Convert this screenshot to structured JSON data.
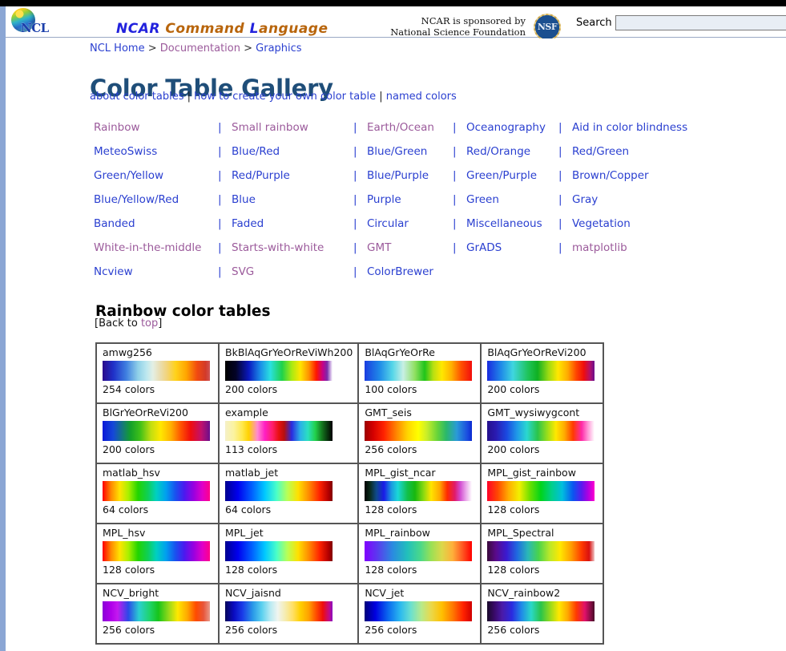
{
  "site": {
    "logo_alt": "NCL",
    "wordmark": [
      {
        "text": "NCAR",
        "color": "#2222dd"
      },
      {
        "text": "Command",
        "color": "#b8650c"
      },
      {
        "text": "L",
        "color": "#2222dd"
      },
      {
        "text": "anguage",
        "color": "#b8650c"
      }
    ],
    "sponsor_line1": "NCAR is sponsored by",
    "sponsor_line2": "National Science Foundation",
    "nsf_seal_text": "NSF"
  },
  "search": {
    "label": "Search",
    "value": "",
    "placeholder": ""
  },
  "breadcrumb": {
    "items": [
      {
        "label": "NCL Home",
        "visited": false
      },
      {
        "label": "Documentation",
        "visited": true
      },
      {
        "label": "Graphics",
        "visited": false
      }
    ],
    "separator": ">"
  },
  "page": {
    "title": "Color Table Gallery",
    "sublinks": [
      {
        "label": "about color tables",
        "visited": false
      },
      {
        "label": "how to create your own color table",
        "visited": false
      },
      {
        "label": "named colors",
        "visited": false
      }
    ],
    "sublink_separator": "|"
  },
  "categories": {
    "separator": "|",
    "rows": [
      [
        {
          "label": "Rainbow",
          "visited": true
        },
        {
          "label": "Small rainbow",
          "visited": true
        },
        {
          "label": "Earth/Ocean",
          "visited": true
        },
        {
          "label": "Oceanography",
          "visited": false
        },
        {
          "label": "Aid in color blindness",
          "visited": false
        }
      ],
      [
        {
          "label": "MeteoSwiss",
          "visited": false
        },
        {
          "label": "Blue/Red",
          "visited": false
        },
        {
          "label": "Blue/Green",
          "visited": false
        },
        {
          "label": "Red/Orange",
          "visited": false
        },
        {
          "label": "Red/Green",
          "visited": false
        }
      ],
      [
        {
          "label": "Green/Yellow",
          "visited": false
        },
        {
          "label": "Red/Purple",
          "visited": false
        },
        {
          "label": "Blue/Purple",
          "visited": false
        },
        {
          "label": "Green/Purple",
          "visited": false
        },
        {
          "label": "Brown/Copper",
          "visited": false
        }
      ],
      [
        {
          "label": "Blue/Yellow/Red",
          "visited": false
        },
        {
          "label": "Blue",
          "visited": false
        },
        {
          "label": "Purple",
          "visited": false
        },
        {
          "label": "Green",
          "visited": false
        },
        {
          "label": "Gray",
          "visited": false
        }
      ],
      [
        {
          "label": "Banded",
          "visited": false
        },
        {
          "label": "Faded",
          "visited": false
        },
        {
          "label": "Circular",
          "visited": false
        },
        {
          "label": "Miscellaneous",
          "visited": false
        },
        {
          "label": "Vegetation",
          "visited": false
        }
      ],
      [
        {
          "label": "White-in-the-middle",
          "visited": true
        },
        {
          "label": "Starts-with-white",
          "visited": true
        },
        {
          "label": "GMT",
          "visited": true
        },
        {
          "label": "GrADS",
          "visited": false
        },
        {
          "label": "matplotlib",
          "visited": true
        }
      ],
      [
        {
          "label": "Ncview",
          "visited": false
        },
        {
          "label": "SVG",
          "visited": true
        },
        {
          "label": "ColorBrewer",
          "visited": false
        },
        {
          "label": "",
          "visited": false
        },
        {
          "label": "",
          "visited": false
        }
      ]
    ]
  },
  "section": {
    "heading": "Rainbow color tables",
    "back_prefix": "[Back to ",
    "back_link": "top",
    "back_suffix": "]"
  },
  "color_tables": [
    {
      "name": "amwg256",
      "count": "254 colors",
      "gradient": "linear-gradient(to right, #2a0a8c 0%, #1f30c8 10%, #3f7fe0 22%, #8fd0e8 33%, #bde8ef 41%, #e4efe4 47%, #e9dfb6 53%, #f2d37a 60%, #ffd21a 68%, #ffa500 78%, #f24a10 88%, #d23a2a 96%, #cf5555 100%)"
    },
    {
      "name": "BkBlAqGrYeOrReViWh200",
      "count": "200 colors",
      "gradient": "linear-gradient(to right, #000000 0%, #030327 10%, #0a18c0 22%, #1a8fe8 33%, #2ae0e0 42%, #1fd24a 53%, #a8ea12 62%, #ffe600 70%, #ff9000 78%, #ff1500 85%, #c4008c 91%, #7a2aa8 95%, #c9a8e0 98%, #ffffff 100%)"
    },
    {
      "name": "BlAqGrYeOrRe",
      "count": "100 colors",
      "gradient": "linear-gradient(to right, #1a3ce0 0%, #1f8ae8 14%, #55d6e8 26%, #c8efe4 36%, #8fe060 47%, #1fc41a 56%, #b8e012 64%, #ffe800 72%, #ffb000 81%, #ff5000 90%, #f20d0d 100%)"
    },
    {
      "name": "BlAqGrYeOrReVi200",
      "count": "200 colors",
      "gradient": "linear-gradient(to right, #1a2ae0 0%, #1f8ae8 13%, #3fd6e0 24%, #1fc45a 38%, #0fb022 47%, #9ada12 57%, #ffe800 66%, #ffab00 75%, #ff4500 83%, #ef0d0d 90%, #b0106e 96%, #6a0f8c 100%)"
    },
    {
      "name": "BlGrYeOrReVi200",
      "count": "200 colors",
      "gradient": "linear-gradient(to right, #0a18d8 0%, #1548d8 10%, #13a02a 26%, #3fc018 35%, #c2de10 45%, #ffe800 54%, #ffae00 64%, #ff5200 73%, #f00d0d 82%, #c0106e 92%, #6a0f8c 100%)"
    },
    {
      "name": "example",
      "count": "113 colors",
      "gradient": "linear-gradient(to right, #f5f0c8 0%, #fbf3a0 8%, #ffe84a 16%, #ffd100 22%, #ff8ad0 30%, #ff1fc4 37%, #ff1f6a 44%, #e81010 50%, #b51010 55%, #2a2ae0 62%, #2ab0e8 70%, #2ae0c0 77%, #22d04a 84%, #147a1f 90%, #0a3a10 95%, #000000 100%)"
    },
    {
      "name": "GMT_seis",
      "count": "256 colors",
      "gradient": "linear-gradient(to right, #9b0000 0%, #d40000 8%, #ff2200 18%, #ff8800 30%, #ffd500 40%, #ffff00 50%, #c8ee2a 58%, #66d43a 68%, #2ab86a 76%, #2a9ad8 86%, #1a4ae0 96%, #0b2ad0 100%)"
    },
    {
      "name": "GMT_wysiwygcont",
      "count": "200 colors",
      "gradient": "linear-gradient(to right, #25108c 0%, #2a1ab0 8%, #1a48e0 18%, #1f9ae8 28%, #2ad8d0 37%, #2ac44a 47%, #9ade1a 56%, #ffe800 64%, #ffab00 72%, #ff3a00 80%, #ff2aa8 88%, #ff9ad8 94%, #ffffff 100%)"
    },
    {
      "name": "matlab_hsv",
      "count": "64 colors",
      "gradient": "linear-gradient(to right, #ff0000 0%, #ff8a00 8%, #ffe400 16%, #aaf000 24%, #22d400 33%, #0fcf55 42%, #00d0c0 50%, #00a0ef 59%, #1a50ef 68%, #4a1aef 76%, #9a00e0 85%, #e000c8 93%, #ff0088 100%)"
    },
    {
      "name": "matlab_jet",
      "count": "64 colors",
      "gradient": "linear-gradient(to right, #00008f 0%, #0000ef 12%, #0060ff 25%, #00c8ff 37%, #4affc8 48%, #b8ff55 58%, #ffe000 68%, #ff8a00 78%, #ff2200 88%, #b50000 96%, #800000 100%)"
    },
    {
      "name": "MPL_gist_ncar",
      "count": "128 colors",
      "gradient": "linear-gradient(to right, #000000 0%, #0a2a1a 5%, #0f4a8a 11%, #1a1ae8 18%, #1a9ae0 25%, #1ad8d8 31%, #12c04a 40%, #18b80f 47%, #8ada10 55%, #ffe400 62%, #ffa800 70%, #ff2a00 77%, #e01a6a 84%, #d24ad0 89%, #e8a0e8 94%, #ffffff 100%)"
    },
    {
      "name": "MPL_gist_rainbow",
      "count": "128 colors",
      "gradient": "linear-gradient(to right, #ff0028 0%, #ff4a00 10%, #ffae00 20%, #f2f000 30%, #6ae000 40%, #00d41a 50%, #00cf8a 60%, #00bede 70%, #0a55f0 80%, #5a1aef 88%, #b000e0 94%, #ff00d0 100%)"
    },
    {
      "name": "MPL_hsv",
      "count": "128 colors",
      "gradient": "linear-gradient(to right, #ff0000 0%, #ff8a00 8%, #ffe400 16%, #aaf000 24%, #22d400 33%, #0fcf55 42%, #00d0c0 50%, #00a0ef 59%, #1a50ef 68%, #4a1aef 76%, #9a00e0 85%, #e000c8 93%, #ff0088 100%)"
    },
    {
      "name": "MPL_jet",
      "count": "128 colors",
      "gradient": "linear-gradient(to right, #00008f 0%, #0000ef 12%, #0060ff 25%, #00c8ff 37%, #4affc8 48%, #b8ff55 58%, #ffe000 68%, #ff8a00 78%, #ff2200 88%, #b50000 96%, #800000 100%)"
    },
    {
      "name": "MPL_rainbow",
      "count": "128 colors",
      "gradient": "linear-gradient(to right, #8000ff 0%, #5a3aee 12%, #2a8ae0 26%, #22c0bb 40%, #4ad88a 52%, #9ae055 62%, #dcd84a 72%, #ffb03a 82%, #ff5a22 91%, #ff0000 100%)"
    },
    {
      "name": "MPL_Spectral",
      "count": "128 colors",
      "gradient": "linear-gradient(to right, #3a0a3a 0%, #5a0a8a 8%, #3a1ad0 18%, #1f6ae0 28%, #2ab8b8 38%, #4ad44a 48%, #b8e82a 58%, #ffe800 68%, #ffa000 78%, #ff3a00 88%, #d81010 95%, #f0c8c8 100%)"
    },
    {
      "name": "NCV_bright",
      "count": "256 colors",
      "gradient": "linear-gradient(to right, #8a00d8 0%, #b000ea 8%, #c41aef 14%, #2a4ae8 24%, #2ad0d0 34%, #1fd46a 44%, #17c41a 52%, #9ada1a 62%, #ffe800 70%, #ffa800 79%, #ff4a00 87%, #e8553a 94%, #e89a8a 100%)"
    },
    {
      "name": "NCV_jaisnd",
      "count": "256 colors",
      "gradient": "linear-gradient(to right, #06065a 0%, #0a0ac0 8%, #1a3ae8 16%, #2a9ae8 26%, #5ad0ef 34%, #b8eaf2 42%, #f0f5f0 49%, #f5ecb0 56%, #ffe066 63%, #ffd000 70%, #ffa000 78%, #ff4a00 85%, #ee0d0d 91%, #c00a8a 97%, #8a0ac0 100%)"
    },
    {
      "name": "NCV_jet",
      "count": "256 colors",
      "gradient": "linear-gradient(to right, #00007a 0%, #0000e0 10%, #0a6aef 22%, #2ab8ef 33%, #6ae0d0 43%, #b8ea8a 53%, #ead84a 62%, #ffc000 72%, #ff7a00 82%, #ff2200 92%, #d00000 100%)"
    },
    {
      "name": "NCV_rainbow2",
      "count": "256 colors",
      "gradient": "linear-gradient(to right, #1a0a2a 0%, #3a0a6a 7%, #4a1aa8 14%, #2a2ae0 23%, #1f8ae8 32%, #2ad8c8 41%, #2ac44a 50%, #9ada1a 59%, #ffe800 67%, #ffa800 75%, #ff3a00 83%, #e0106a 91%, #4a0a2a 100%)"
    }
  ]
}
